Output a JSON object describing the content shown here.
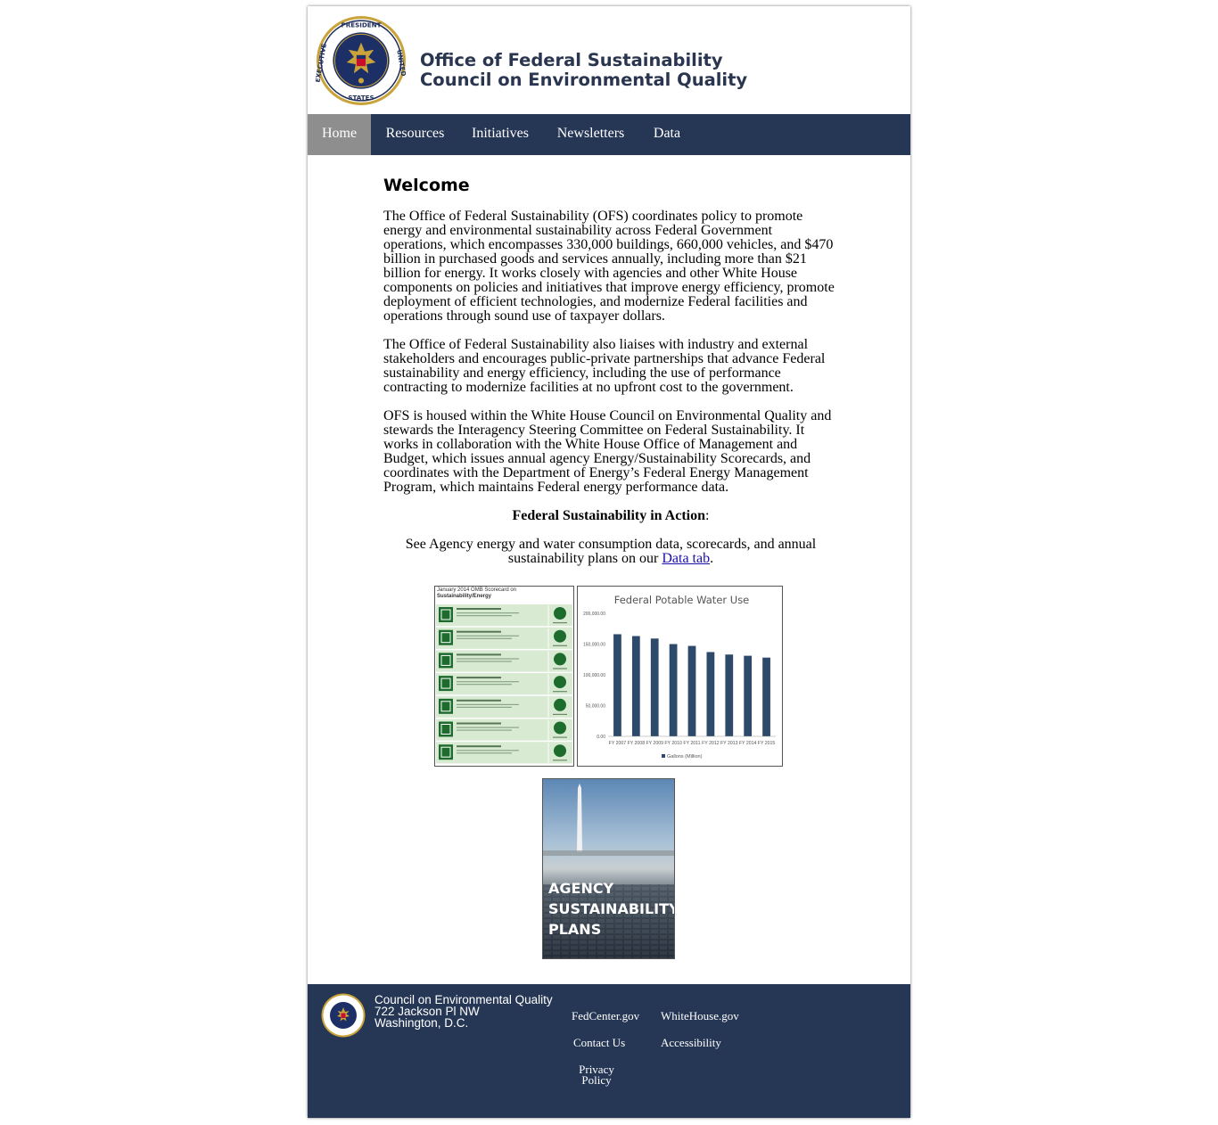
{
  "header": {
    "title_line1": "Office of Federal Sustainability",
    "title_line2": "Council on Environmental Quality"
  },
  "nav": {
    "items": [
      {
        "label": "Home",
        "active": true
      },
      {
        "label": "Resources",
        "active": false
      },
      {
        "label": "Initiatives",
        "active": false
      },
      {
        "label": "Newsletters",
        "active": false
      },
      {
        "label": "Data",
        "active": false
      }
    ]
  },
  "main": {
    "heading": "Welcome",
    "paragraph1": "The Office of Federal Sustainability (OFS) coordinates policy to promote energy and environmental sustainability across Federal Government operations, which encompasses 330,000 buildings, 660,000 vehicles, and $470 billion in purchased goods and services annually, including more than $21 billion for energy. It works closely with agencies and other White House components on policies and initiatives that improve energy efficiency, promote deployment of efficient technologies, and modernize Federal facilities and operations through sound use of taxpayer dollars.",
    "paragraph2": "The Office of Federal Sustainability also liaises with industry and external stakeholders and encourages public-private partnerships that advance Federal sustainability and energy efficiency, including the use of performance contracting to modernize facilities at no upfront cost to the government.",
    "paragraph3": "OFS is housed within the White House Council on Environmental Quality and stewards the Interagency Steering Committee on Federal Sustainability. It works in collaboration with the White House Office of Management and Budget, which issues annual agency Energy/Sustainability Scorecards, and coordinates with the Department of Energy’s Federal Energy Management Program, which maintains Federal energy performance data.",
    "action_heading": "Federal Sustainability in Action",
    "action_colon": ":",
    "data_text_before": "See Agency energy and water consumption data, scorecards, and annual sustainability plans on our ",
    "data_link": "Data tab",
    "data_text_after": "."
  },
  "scorecard_thumb": {
    "title_line1": "January 2014 OMB Scorecard on",
    "title_line2": "Sustainability/Energy",
    "rows": 7,
    "status_color": "#1e6b2e",
    "background": "#d8ead2"
  },
  "plans_thumb": {
    "line1": "AGENCY",
    "line2": "SUSTAINABILITY",
    "line3": "PLANS"
  },
  "chart_data": {
    "type": "bar",
    "title": "Federal Potable Water Use",
    "categories": [
      "FY 2007",
      "FY 2008",
      "FY 2009",
      "FY 2010",
      "FY 2011",
      "FY 2012",
      "FY 2013",
      "FY 2014",
      "FY 2015"
    ],
    "series": [
      {
        "name": "Gallons (Million)",
        "values": [
          166000,
          163000,
          159000,
          150000,
          147000,
          137000,
          133000,
          131000,
          128000
        ]
      }
    ],
    "yticks": [
      "0.00",
      "50,000.00",
      "100,000.00",
      "150,000.00",
      "200,000.00"
    ],
    "ylim": [
      0,
      200000
    ],
    "bar_color": "#2e4a6b",
    "legend_position": "bottom",
    "grid": false
  },
  "footer": {
    "address_line1": "Council on Environmental Quality",
    "address_line2": "722 Jackson Pl NW",
    "address_line3": "Washington, D.C.",
    "links": {
      "fedcenter": "FedCenter.gov",
      "whitehouse": "WhiteHouse.gov",
      "contact": "Contact Us",
      "accessibility": "Accessibility",
      "privacy_line1": "Privacy",
      "privacy_line2": "Policy"
    }
  },
  "colors": {
    "nav_bg": "#263755",
    "nav_active": "#8e8e8e",
    "footer_bg": "#263755",
    "title_color": "#2a3550",
    "link_color": "#1a0dab"
  },
  "icons": [
    "presidential-seal-icon",
    "footer-seal-icon"
  ]
}
